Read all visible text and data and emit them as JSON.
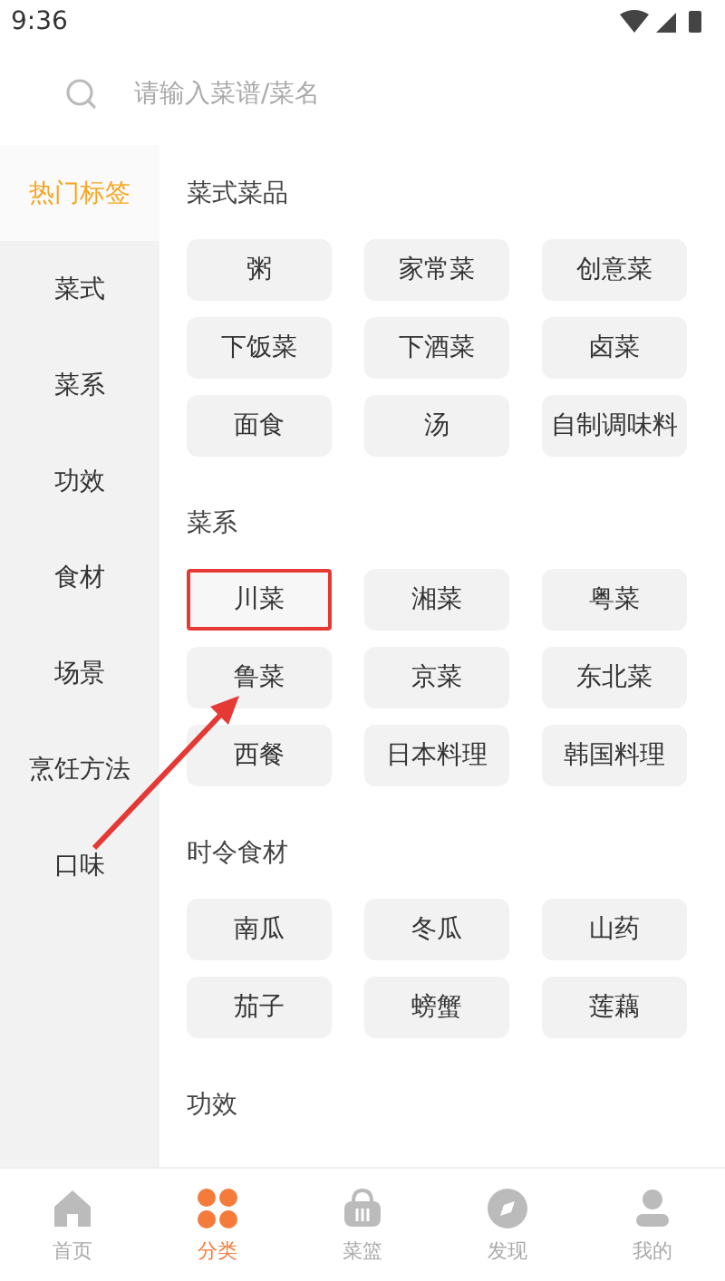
{
  "status_bar": {
    "time": "9:36"
  },
  "search": {
    "placeholder": "请输入菜谱/菜名"
  },
  "sidebar": {
    "items": [
      {
        "label": "热门标签",
        "selected": true
      },
      {
        "label": "菜式",
        "selected": false
      },
      {
        "label": "菜系",
        "selected": false
      },
      {
        "label": "功效",
        "selected": false
      },
      {
        "label": "食材",
        "selected": false
      },
      {
        "label": "场景",
        "selected": false
      },
      {
        "label": "烹饪方法",
        "selected": false
      },
      {
        "label": "口味",
        "selected": false
      }
    ]
  },
  "sections": [
    {
      "title": "菜式菜品",
      "tags": [
        {
          "label": "粥",
          "highlighted": false
        },
        {
          "label": "家常菜",
          "highlighted": false
        },
        {
          "label": "创意菜",
          "highlighted": false
        },
        {
          "label": "下饭菜",
          "highlighted": false
        },
        {
          "label": "下酒菜",
          "highlighted": false
        },
        {
          "label": "卤菜",
          "highlighted": false
        },
        {
          "label": "面食",
          "highlighted": false
        },
        {
          "label": "汤",
          "highlighted": false
        },
        {
          "label": "自制调味料",
          "highlighted": false
        }
      ]
    },
    {
      "title": "菜系",
      "tags": [
        {
          "label": "川菜",
          "highlighted": true
        },
        {
          "label": "湘菜",
          "highlighted": false
        },
        {
          "label": "粤菜",
          "highlighted": false
        },
        {
          "label": "鲁菜",
          "highlighted": false
        },
        {
          "label": "京菜",
          "highlighted": false
        },
        {
          "label": "东北菜",
          "highlighted": false
        },
        {
          "label": "西餐",
          "highlighted": false
        },
        {
          "label": "日本料理",
          "highlighted": false
        },
        {
          "label": "韩国料理",
          "highlighted": false
        }
      ]
    },
    {
      "title": "时令食材",
      "tags": [
        {
          "label": "南瓜",
          "highlighted": false
        },
        {
          "label": "冬瓜",
          "highlighted": false
        },
        {
          "label": "山药",
          "highlighted": false
        },
        {
          "label": "茄子",
          "highlighted": false
        },
        {
          "label": "螃蟹",
          "highlighted": false
        },
        {
          "label": "莲藕",
          "highlighted": false
        }
      ]
    },
    {
      "title": "功效"
    }
  ],
  "tab_bar": [
    {
      "label": "首页",
      "kind": "home",
      "selected": false
    },
    {
      "label": "分类",
      "kind": "grid",
      "selected": true
    },
    {
      "label": "菜篮",
      "kind": "basket",
      "selected": false
    },
    {
      "label": "发现",
      "kind": "compass",
      "selected": false
    },
    {
      "label": "我的",
      "kind": "person",
      "selected": false
    }
  ]
}
